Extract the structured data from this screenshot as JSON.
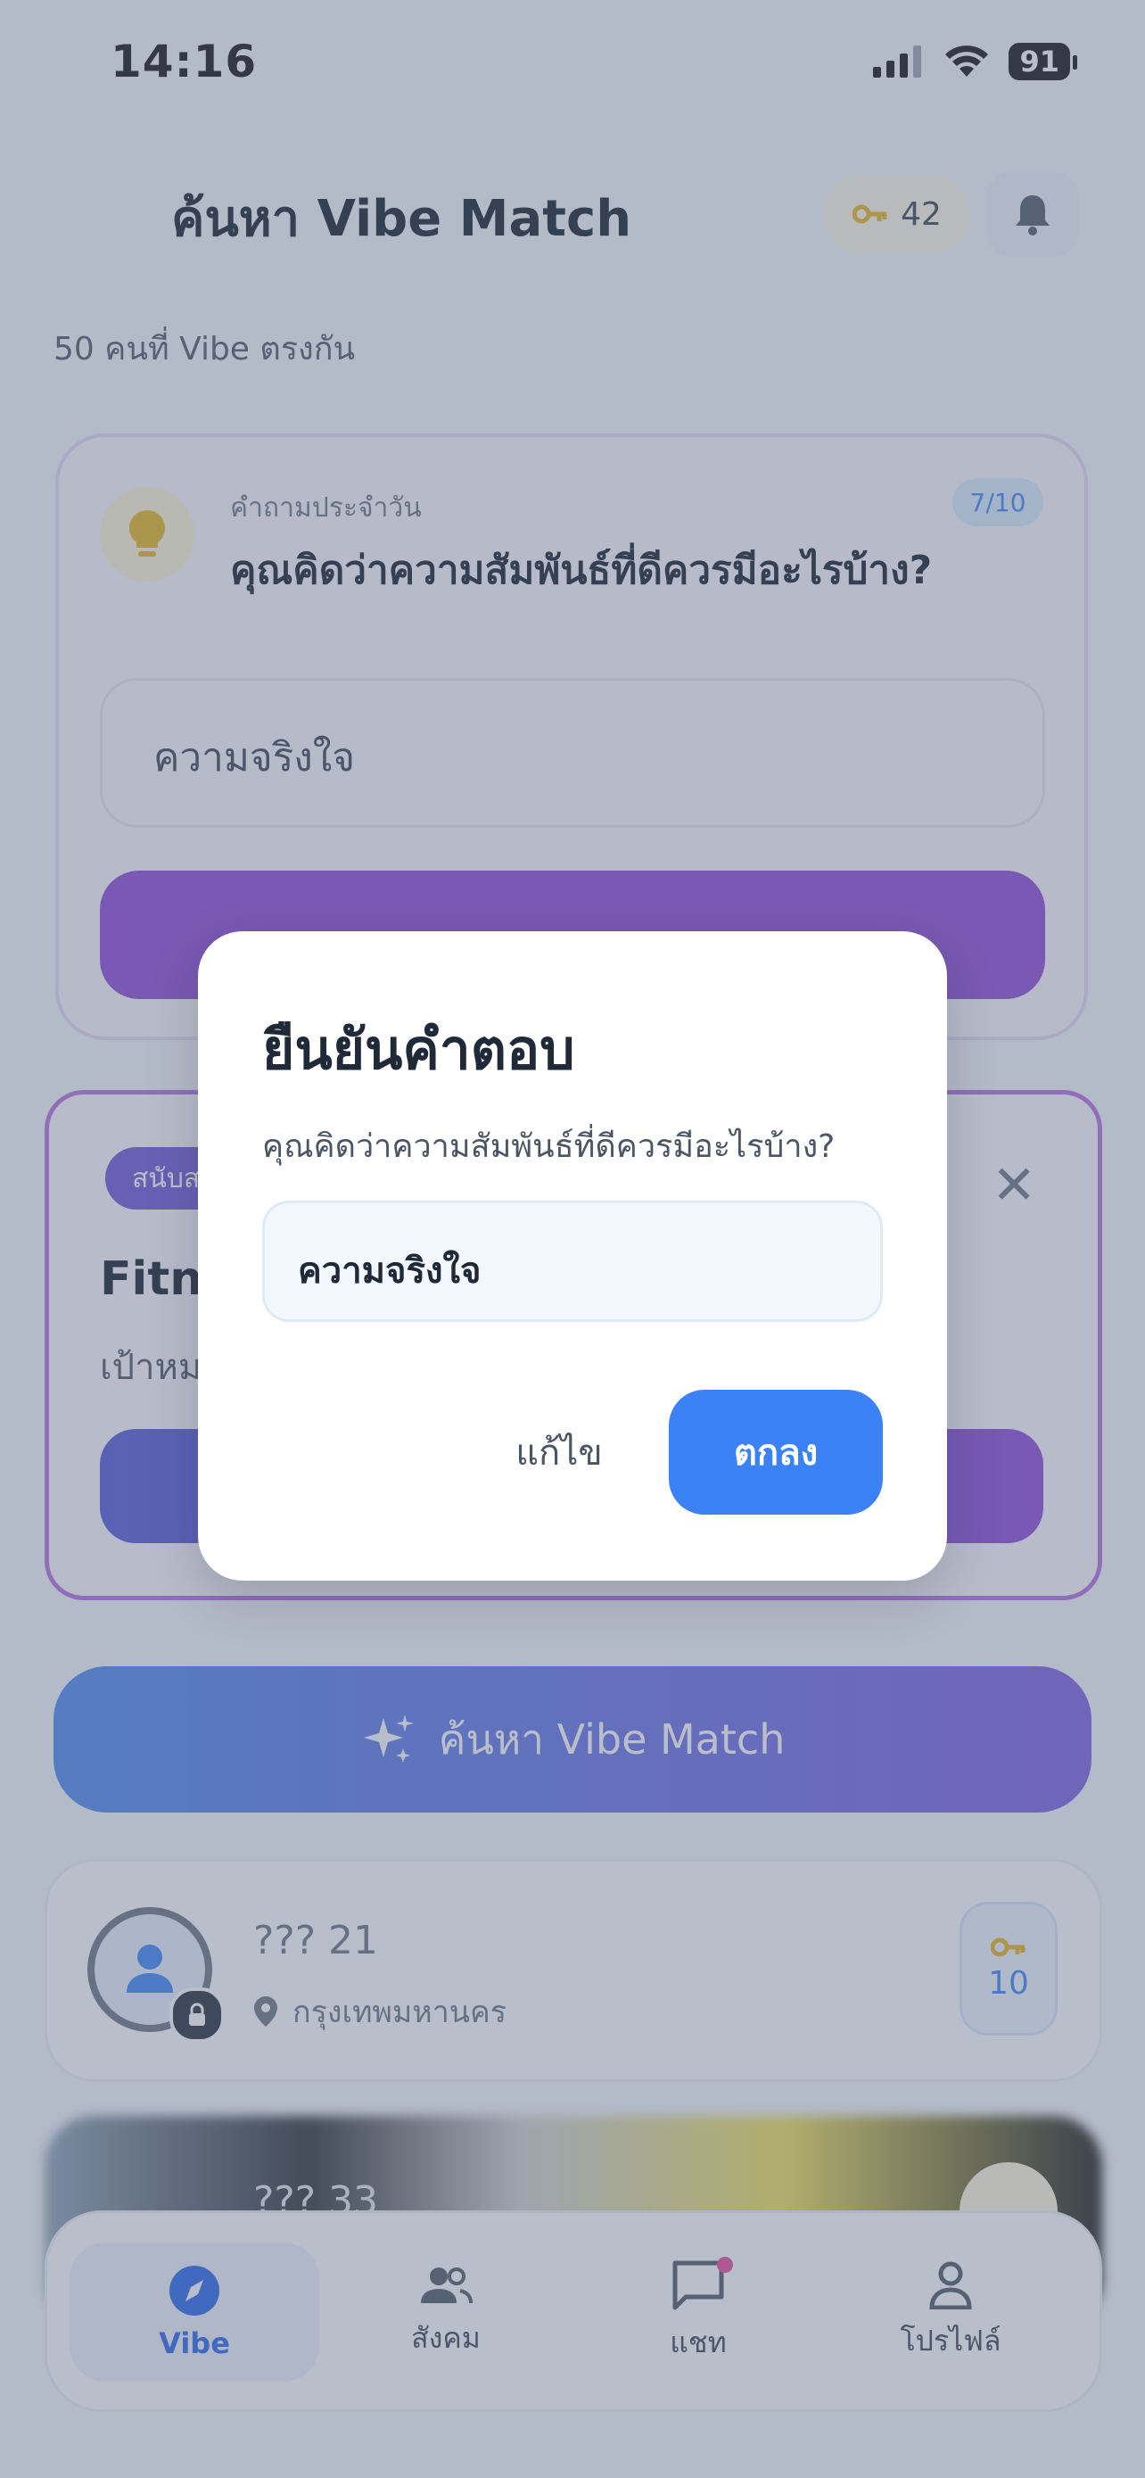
{
  "status_bar": {
    "time": "14:16",
    "battery": "91"
  },
  "header": {
    "title": "ค้นหา Vibe Match",
    "keys": "42"
  },
  "match_count": "50 คนที่ Vibe ตรงกัน",
  "daily_question": {
    "label": "คำถามประจำวัน",
    "counter": "7/10",
    "question": "คุณคิดว่าความสัมพันธ์ที่ดีควรมีอะไรบ้าง?",
    "answer": "ความจริงใจ"
  },
  "promo": {
    "badge": "สนับสนุน",
    "title": "Fitne",
    "subtitle": "เป้าหม"
  },
  "vibe_button": {
    "label": "ค้นหา Vibe Match"
  },
  "people": [
    {
      "name": "??? 21",
      "location": "กรุงเทพมหานคร",
      "key_cost": "10"
    },
    {
      "name": "??? 33"
    }
  ],
  "bottom_nav": [
    {
      "label": "Vibe",
      "icon": "compass-icon",
      "active": true
    },
    {
      "label": "สังคม",
      "icon": "people-icon"
    },
    {
      "label": "แชท",
      "icon": "chat-icon"
    },
    {
      "label": "โปรไฟล์",
      "icon": "person-icon"
    }
  ],
  "modal": {
    "title": "ยืนยันคำตอบ",
    "question": "คุณคิดว่าความสัมพันธ์ที่ดีควรมีอะไรบ้าง?",
    "answer": "ความจริงใจ",
    "edit_label": "แก้ไข",
    "confirm_label": "ตกลง"
  },
  "colors": {
    "accent": "#3b82f6",
    "purple": "#8a45d6",
    "key_gold": "#e8b21a"
  }
}
